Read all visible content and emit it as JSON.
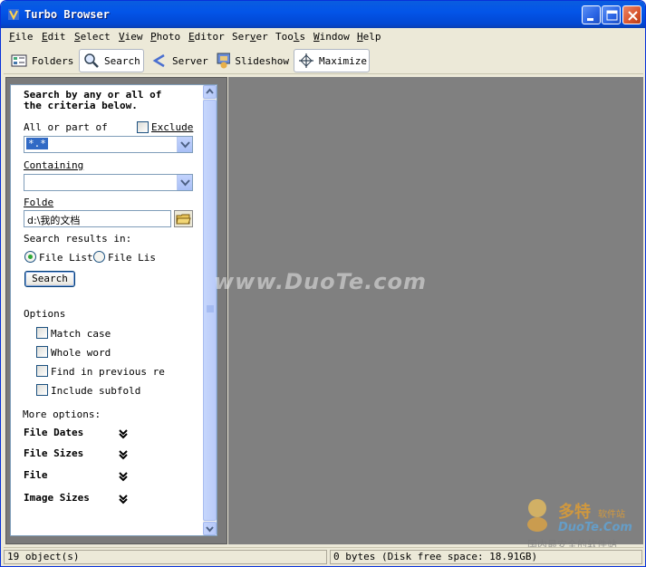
{
  "window": {
    "title": "Turbo Browser"
  },
  "menu": [
    {
      "u": "F",
      "rest": "ile"
    },
    {
      "u": "E",
      "rest": "dit"
    },
    {
      "u": "S",
      "rest": "elect"
    },
    {
      "u": "V",
      "rest": "iew",
      "pre": ""
    },
    {
      "u": "P",
      "rest": "hoto"
    },
    {
      "u": "E",
      "rest": "ditor"
    },
    {
      "u": "v",
      "rest": "",
      "pre": "Ser",
      "post": "er"
    },
    {
      "u": "l",
      "pre": "Too",
      "rest": "s"
    },
    {
      "u": "W",
      "rest": "indow"
    },
    {
      "u": "H",
      "rest": "elp"
    }
  ],
  "toolbar": {
    "folders": "Folders",
    "search": "Search",
    "server": "Server",
    "slideshow": "Slideshow",
    "maximize": "Maximize"
  },
  "search_panel": {
    "intro_line1": "Search by any or all of",
    "intro_line2": "the criteria below.",
    "name_label": "All or part of",
    "exclude_label": "Exclude",
    "name_value": "*.*",
    "containing_label": "Containing",
    "containing_value": "",
    "folder_label": "Folde",
    "folder_value": "d:\\我的文档",
    "results_in_label": "Search results in:",
    "radio_option_1": "File List",
    "radio_option_2": "File Lis",
    "search_button": "Search",
    "options_label": "Options",
    "opt_match_case": "Match case",
    "opt_whole_word": "Whole word",
    "opt_find_prev": "Find in previous re",
    "opt_include_sub": "Include subfold",
    "more_options_label": "More options:",
    "more": [
      "File Dates",
      "File Sizes",
      "File",
      "Image Sizes"
    ]
  },
  "status": {
    "objects": "19 object(s)",
    "disk": "0 bytes (Disk free space: 18.91GB)"
  },
  "watermark": "www.DuoTe.com",
  "logo": {
    "cn": "多特",
    "sub": "软件站",
    "brand": "DuoTe.Com",
    "tagline": "国内最安全的软件站"
  },
  "colors": {
    "titlebar": "#0355e8",
    "right_pane": "#808080",
    "radio_dot": "#2da836"
  }
}
